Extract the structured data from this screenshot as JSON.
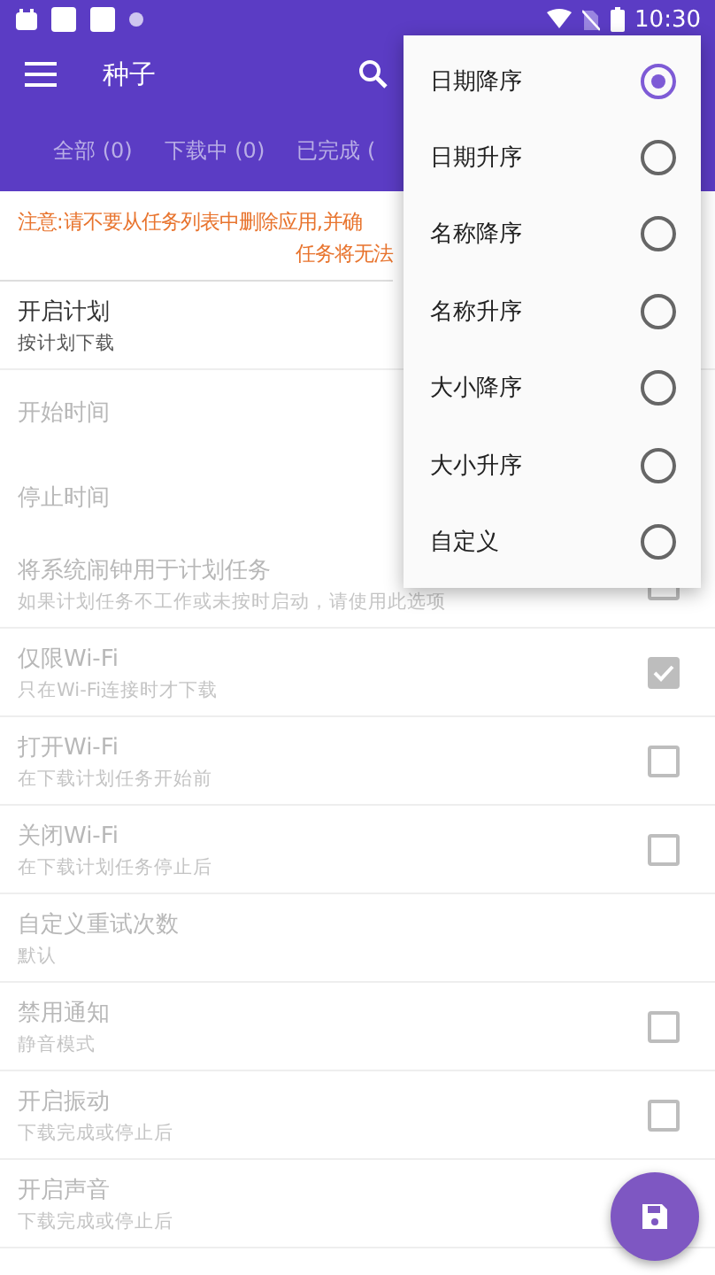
{
  "status_bar": {
    "time": "10:30"
  },
  "app_bar": {
    "title": "种子"
  },
  "tabs": [
    {
      "label": "全部 (0)",
      "selected": false
    },
    {
      "label": "下载中 (0)",
      "selected": false
    },
    {
      "label": "已完成 (",
      "selected": false
    }
  ],
  "notice": {
    "line_1": "注意:请不要从任务列表中删除应用,并确",
    "line_2": "任务将无法"
  },
  "settings": [
    {
      "kind": "text",
      "title": "开启计划",
      "subtitle": "按计划下载",
      "disabled": false
    },
    {
      "kind": "time",
      "title": "开始时间",
      "disabled": true
    },
    {
      "kind": "time",
      "title": "停止时间",
      "disabled": true
    },
    {
      "kind": "checkbox",
      "title": "将系统闹钟用于计划任务",
      "subtitle": "如果计划任务不工作或未按时启动，请使用此选项",
      "disabled": true,
      "checked": false
    },
    {
      "kind": "checkbox",
      "title": "仅限Wi-Fi",
      "subtitle": "只在Wi-Fi连接时才下载",
      "disabled": true,
      "checked": true
    },
    {
      "kind": "checkbox",
      "title": "打开Wi-Fi",
      "subtitle": "在下载计划任务开始前",
      "disabled": true,
      "checked": false
    },
    {
      "kind": "checkbox",
      "title": "关闭Wi-Fi",
      "subtitle": "在下载计划任务停止后",
      "disabled": true,
      "checked": false
    },
    {
      "kind": "text",
      "title": "自定义重试次数",
      "subtitle": "默认",
      "disabled": true
    },
    {
      "kind": "checkbox",
      "title": "禁用通知",
      "subtitle": "静音模式",
      "disabled": true,
      "checked": false
    },
    {
      "kind": "checkbox",
      "title": "开启振动",
      "subtitle": "下载完成或停止后",
      "disabled": true,
      "checked": false
    },
    {
      "kind": "text",
      "title": "开启声音",
      "subtitle": "下载完成或停止后",
      "disabled": true
    }
  ],
  "sort_menu": [
    {
      "label": "日期降序",
      "selected": true
    },
    {
      "label": "日期升序",
      "selected": false
    },
    {
      "label": "名称降序",
      "selected": false
    },
    {
      "label": "名称升序",
      "selected": false
    },
    {
      "label": "大小降序",
      "selected": false
    },
    {
      "label": "大小升序",
      "selected": false
    },
    {
      "label": "自定义",
      "selected": false
    }
  ]
}
